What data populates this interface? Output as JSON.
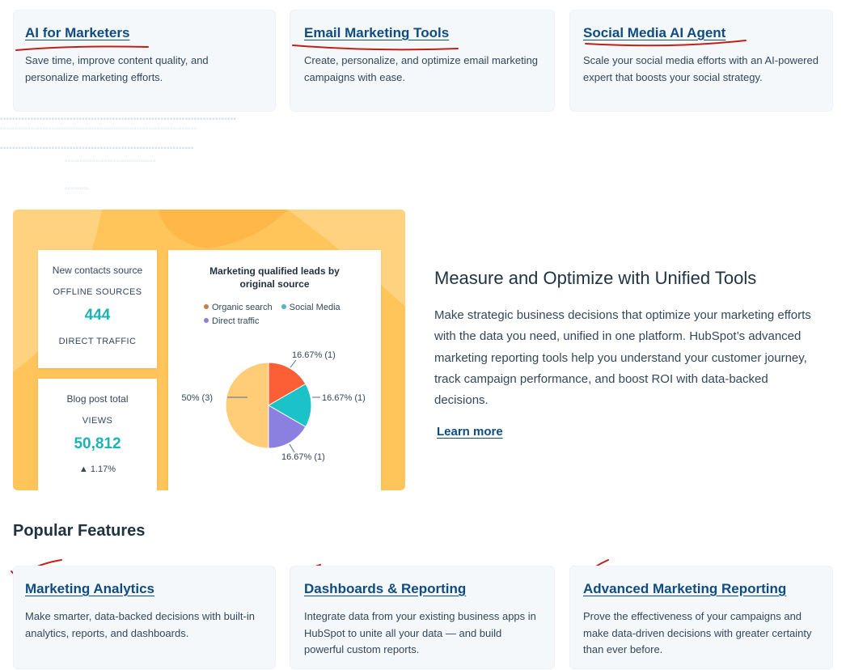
{
  "top_cards": [
    {
      "title": "AI for Marketers",
      "desc": "Save time, improve content quality, and personalize marketing efforts."
    },
    {
      "title": "Email Marketing Tools",
      "desc": "Create, personalize, and optimize email marketing campaigns with ease."
    },
    {
      "title": "Social Media AI Agent",
      "desc": "Scale your social media efforts with an AI-powered expert that boosts your social strategy."
    }
  ],
  "dashboard": {
    "contacts": {
      "title": "New contacts source",
      "label1": "OFFLINE SOURCES",
      "value": "444",
      "label2": "DIRECT TRAFFIC"
    },
    "blog": {
      "title": "Blog post total",
      "label": "VIEWS",
      "value": "50,812",
      "change": "▲ 1.17%"
    },
    "pie": {
      "title": "Marketing qualified leads by original source",
      "legend": [
        {
          "label": "Organic search",
          "color": "#c87d42"
        },
        {
          "label": "Social Media",
          "color": "#4fb3c9"
        },
        {
          "label": "Direct traffic",
          "color": "#8b7fe0"
        }
      ]
    }
  },
  "chart_data": {
    "type": "pie",
    "title": "Marketing qualified leads by original source",
    "slices": [
      {
        "label": "Organic search",
        "value": 1,
        "text": "16.67% (1)",
        "color": "#fc5e36"
      },
      {
        "label": "Social Media",
        "value": 1,
        "text": "16.67% (1)",
        "color": "#1bc3c8"
      },
      {
        "label": "Direct traffic",
        "value": 1,
        "text": "16.67% (1)",
        "color": "#8b7fe0"
      },
      {
        "label": "",
        "value": 3,
        "text": "50% (3)",
        "color": "#ffcd78"
      }
    ]
  },
  "measure": {
    "heading": "Measure and Optimize with Unified Tools",
    "body": "Make strategic business decisions that optimize your marketing efforts with the data you need, unified in one platform. HubSpot’s advanced marketing reporting tools help you understand your customer journey, track campaign performance, and boost ROI with data-backed decisions.",
    "link": "Learn more"
  },
  "features": {
    "title": "Popular Features",
    "cards": [
      {
        "title": "Marketing Analytics",
        "desc": "Make smarter, data-backed decisions with built-in analytics, reports, and dashboards."
      },
      {
        "title": "Dashboards & Reporting",
        "desc": "Integrate data from your existing business apps in HubSpot to unite all your data — and build powerful custom reports."
      },
      {
        "title": "Advanced Marketing Reporting",
        "desc": "Prove the effectiveness of your campaigns and make data-driven  decisions with greater certainty than ever before."
      }
    ]
  },
  "colors": {
    "link": "#0f4c81",
    "annotation": "#c0201a",
    "panel": "#ffc55a",
    "kpi": "#1bb3b6"
  }
}
